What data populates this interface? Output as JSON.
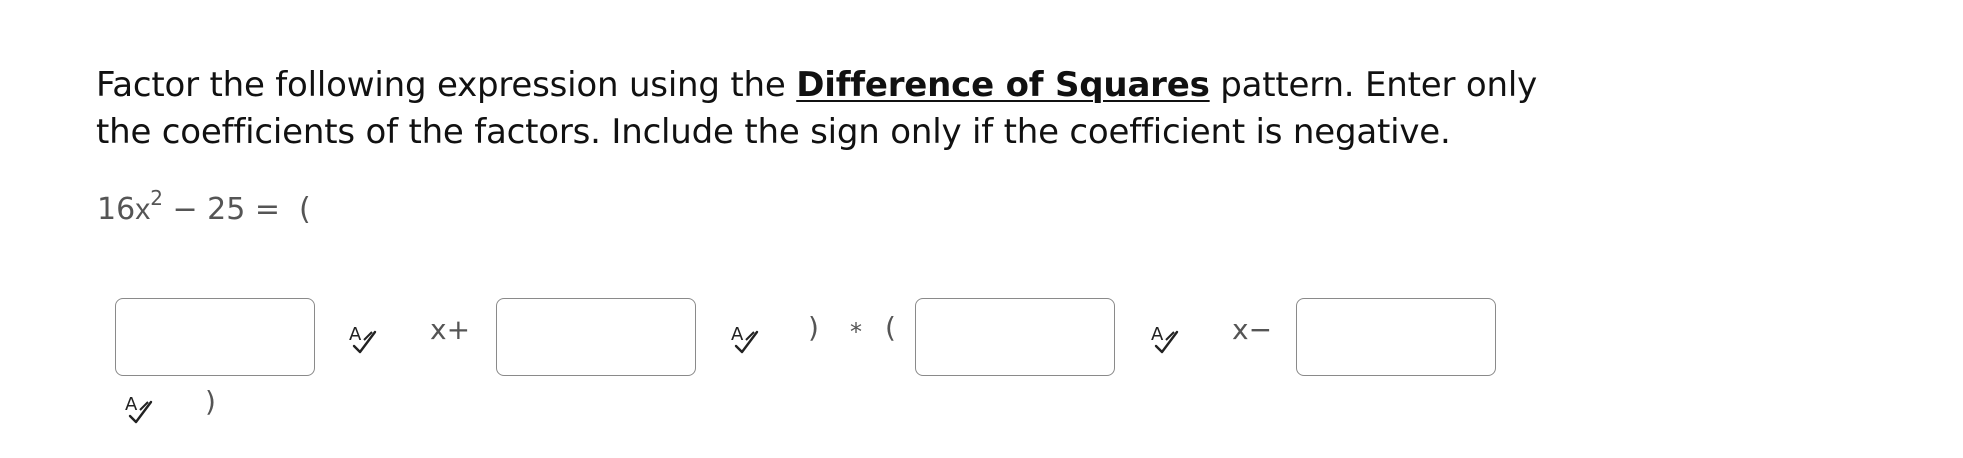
{
  "prompt": {
    "part1": "Factor the following expression using the ",
    "link": "Difference of Squares",
    "part2": " pattern.  Enter only the coefficients of the factors.  Include the sign only if the coefficient is negative."
  },
  "equation": {
    "coef": "16",
    "var": "x",
    "exp": "2",
    "rest": " − 25 =  ("
  },
  "tokens": {
    "x_plus": "x+",
    "close_star_open_close": ")",
    "star": "*",
    "open": "(",
    "x_minus": "x−",
    "final_close": ")"
  },
  "inputs": [
    {
      "value": ""
    },
    {
      "value": ""
    },
    {
      "value": ""
    },
    {
      "value": ""
    }
  ],
  "icons": {
    "spell_check": "spell-check-icon"
  }
}
